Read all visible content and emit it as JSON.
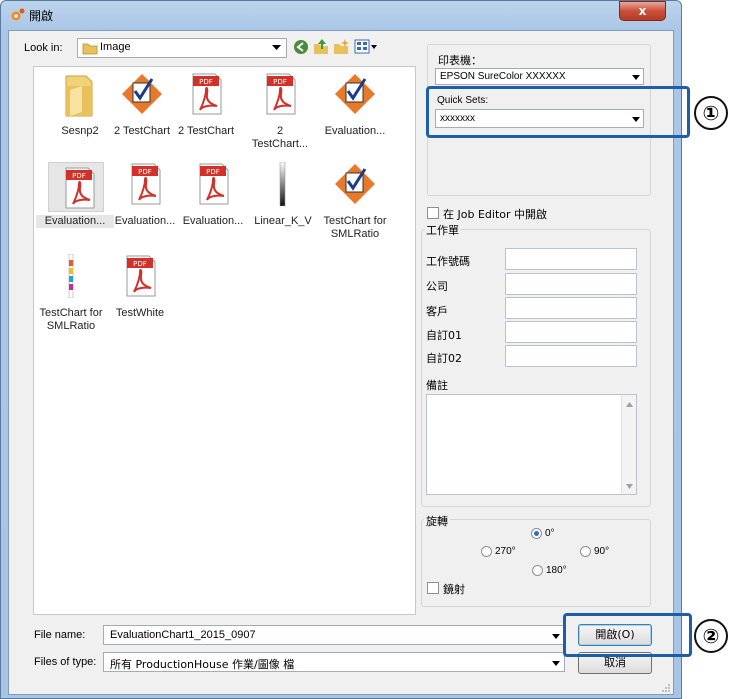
{
  "window": {
    "title": "開啟",
    "close_label": "x"
  },
  "toolbar": {
    "look_in_label": "Look in:",
    "look_in_value": "Image"
  },
  "files": [
    {
      "label": "Sesnp2",
      "icon": "folder-icon"
    },
    {
      "label": "2 TestChart",
      "icon": "checkmark-doc-icon"
    },
    {
      "label": "2 TestChart",
      "icon": "pdf-icon"
    },
    {
      "label": "2 TestChart...",
      "icon": "pdf-icon"
    },
    {
      "label": "Evaluation...",
      "icon": "checkmark-doc-icon"
    },
    {
      "label": "Evaluation...",
      "icon": "pdf-icon"
    },
    {
      "label": "Evaluation...",
      "icon": "pdf-icon"
    },
    {
      "label": "Evaluation...",
      "icon": "pdf-icon"
    },
    {
      "label": "Linear_K_V",
      "icon": "gradient-strip-icon"
    },
    {
      "label": "TestChart for SMLRatio",
      "icon": "checkmark-doc-icon"
    },
    {
      "label": "TestChart for SMLRatio",
      "icon": "color-strip-icon"
    },
    {
      "label": "TestWhite",
      "icon": "pdf-icon"
    }
  ],
  "pdf_badge": "PDF",
  "printer": {
    "label": "印表機：",
    "value": "EPSON SureColor XXXXXX"
  },
  "quick_sets": {
    "label": "Quick Sets:",
    "value": "xxxxxxx"
  },
  "job_editor": {
    "label": "在 Job Editor 中開啟",
    "checked": false
  },
  "work_order": {
    "title": "工作單",
    "fields": [
      {
        "label": "工作號碼",
        "value": ""
      },
      {
        "label": "公司",
        "value": ""
      },
      {
        "label": "客戶",
        "value": ""
      },
      {
        "label": "自訂01",
        "value": ""
      },
      {
        "label": "自訂02",
        "value": ""
      }
    ],
    "notes_label": "備註"
  },
  "rotation": {
    "title": "旋轉",
    "options": {
      "r0": "0°",
      "r270": "270°",
      "r90": "90°",
      "r180": "180°"
    },
    "selected": "0°",
    "mirror_label": "鏡射"
  },
  "file_name": {
    "label": "File name:",
    "value": "EvaluationChart1_2015_0907"
  },
  "file_type": {
    "label": "Files of type:",
    "value": "所有 ProductionHouse 作業/圖像 檔"
  },
  "buttons": {
    "open": "開啟(O)",
    "cancel": "取消"
  },
  "callouts": {
    "one": "①",
    "two": "②"
  },
  "colors": {
    "callout_border": "#1e5ea8",
    "accent": "#2a6fc9"
  }
}
